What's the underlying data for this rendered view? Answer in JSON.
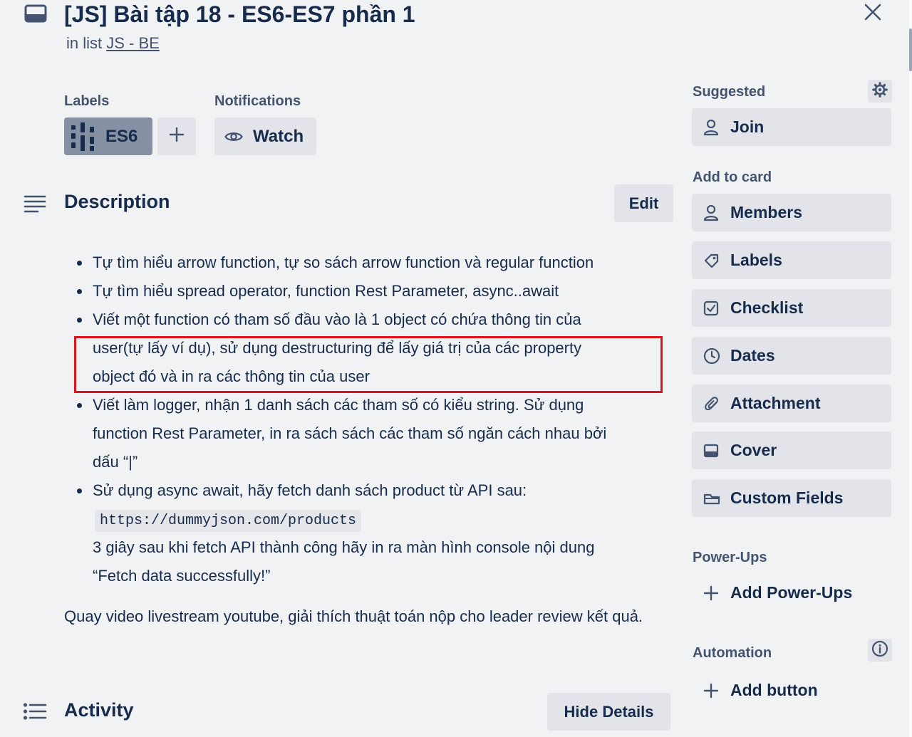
{
  "header": {
    "title": "[JS] Bài tập 18 - ES6-ES7 phần 1",
    "in_list_prefix": "in list",
    "list_name": "JS - BE"
  },
  "labels": {
    "title": "Labels",
    "items": [
      {
        "name": "ES6",
        "color": "#8590a2"
      }
    ]
  },
  "notifications": {
    "title": "Notifications",
    "watch_label": "Watch"
  },
  "description": {
    "title": "Description",
    "edit_label": "Edit",
    "bullets": {
      "b1": "Tự tìm hiểu arrow function, tự so sách arrow function và regular function",
      "b2": "Tự tìm hiểu spread operator, function Rest Parameter, async..await",
      "b3_line1": "Viết một function có tham số đầu vào là 1 object có chứa thông tin của",
      "b3_line2": "user(tự lấy ví dụ), sử dụng destructuring để lấy giá trị của các property",
      "b3_line3": "object đó và in ra các thông tin của user",
      "b4_line1": "Viết làm logger, nhận 1 danh sách các tham số có kiểu string. Sử dụng",
      "b4_line2": "function Rest Parameter, in ra sách sách các tham số ngăn cách nhau bởi",
      "b4_line3": "dấu “|”",
      "b5_line1": "Sử dụng async await, hãy fetch danh sách product từ API sau:",
      "b5_code": "https://dummyjson.com/products",
      "b5_line2": "3 giây sau khi fetch API thành công hãy in ra màn hình console nội dung",
      "b5_line3": "“Fetch data successfully!”"
    },
    "paragraph": "Quay video livestream youtube, giải thích thuật toán nộp cho leader review kết quả."
  },
  "activity": {
    "title": "Activity",
    "hide_details_label": "Hide Details"
  },
  "sidebar": {
    "suggested_title": "Suggested",
    "join_label": "Join",
    "add_to_card_title": "Add to card",
    "add_to_card": {
      "members": "Members",
      "labels": "Labels",
      "checklist": "Checklist",
      "dates": "Dates",
      "attachment": "Attachment",
      "cover": "Cover",
      "custom_fields": "Custom Fields"
    },
    "power_ups_title": "Power-Ups",
    "add_power_ups_label": "Add Power-Ups",
    "automation_title": "Automation",
    "add_button_label": "Add button"
  },
  "colors": {
    "background": "#f1f2f4",
    "button": "#e2e4e9",
    "text": "#172b4d",
    "highlight": "#e0141d"
  }
}
